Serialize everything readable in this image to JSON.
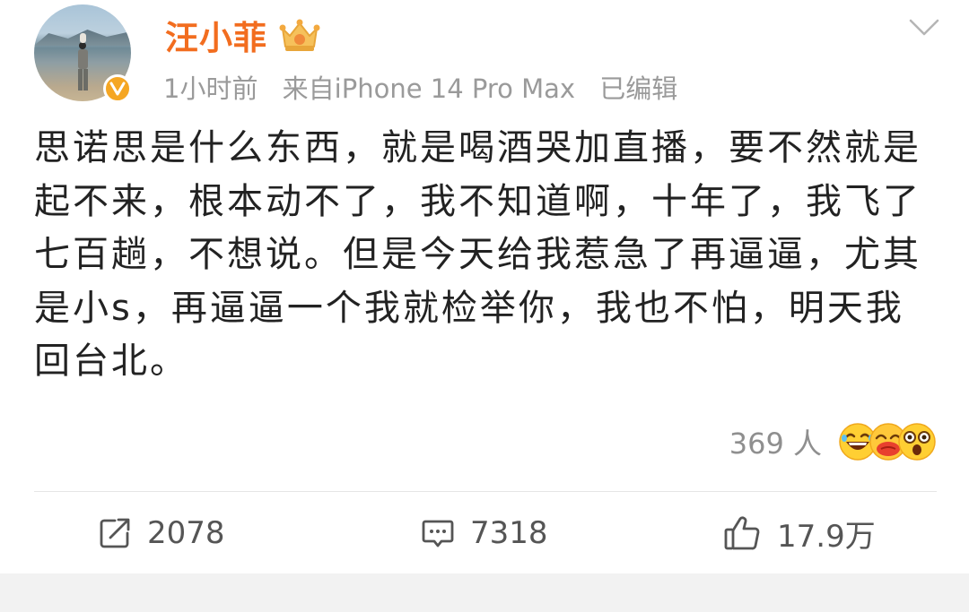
{
  "post": {
    "username": "汪小菲",
    "time": "1小时前",
    "source": "来自iPhone 14 Pro Max",
    "edited": "已编辑",
    "content": "思诺思是什么东西，就是喝酒哭加直播，要不然就是起不来，根本动不了，我不知道啊，十年了，我飞了七百趟，不想说。但是今天给我惹急了再逼逼，尤其是小s，再逼逼一个我就检举你，我也不怕，明天我回台北。"
  },
  "reactions": {
    "count_label": "369 人",
    "emojis": [
      "laughing-icon",
      "kiss-icon",
      "shocked-icon"
    ]
  },
  "actions": {
    "repost": "2078",
    "comment": "7318",
    "like": "17.9万"
  },
  "colors": {
    "username": "#f26d1f",
    "verified": "#f5a623",
    "meta": "#9a9a9a",
    "text": "#222222"
  }
}
